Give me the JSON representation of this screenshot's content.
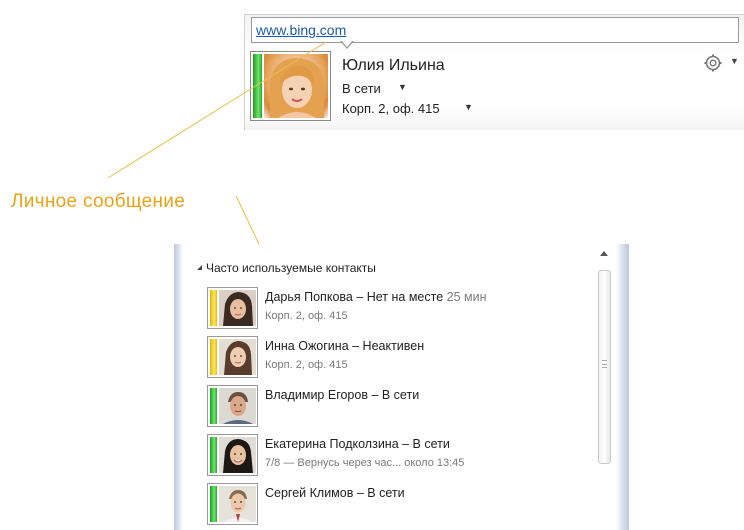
{
  "contact_card": {
    "personal_note": "www.bing.com",
    "name": "Юлия Ильина",
    "status": "В сети",
    "location": "Корп. 2, оф. 415"
  },
  "annotation": {
    "callout": "Личное сообщение",
    "color": "#e8a417"
  },
  "contact_list": {
    "group_header": "Часто используемые контакты",
    "contacts": [
      {
        "name": "Дарья Попкова – Нет на месте",
        "time": " 25 мин",
        "sub": "Корп. 2, оф. 415",
        "status_color": "#f2cf22"
      },
      {
        "name": "Инна Ожогина – Неактивен",
        "time": "",
        "sub": "Корп. 2, оф. 415",
        "status_color": "#f2cf22"
      },
      {
        "name": "Владимир Егоров – В сети",
        "time": "",
        "sub": "",
        "status_color": "#3cc23c"
      },
      {
        "name": "Екатерина Подколзина – В сети",
        "time": "",
        "sub": "7/8 — Вернусь через час... около 13:45",
        "status_color": "#3cc23c"
      },
      {
        "name": "Сергей Климов – В сети",
        "time": "",
        "sub": "",
        "status_color": "#3cc23c"
      }
    ]
  },
  "icons": {
    "gear": "gear-icon",
    "dropdown": "chevron-down-icon",
    "collapse": "triangle-icon",
    "scroll_up": "scroll-up-arrow"
  }
}
